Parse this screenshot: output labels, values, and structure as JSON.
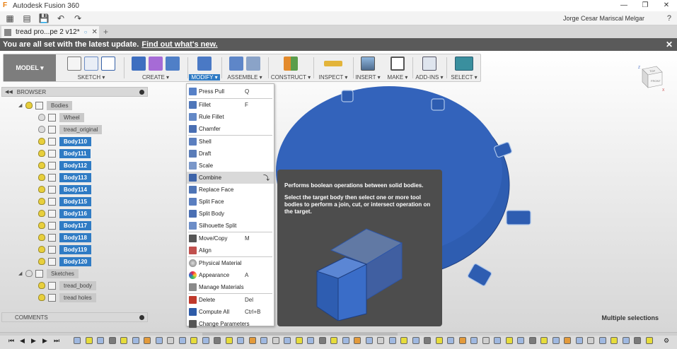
{
  "window": {
    "title": "Autodesk Fusion 360",
    "controls": [
      "—",
      "❐",
      "✕"
    ]
  },
  "app_toolbar": {
    "user_name": "Jorge Cesar Mariscal Melgar",
    "help": "?"
  },
  "document_tab": {
    "label": "tread pro...pe 2 v12*",
    "close": "✕",
    "add": "+"
  },
  "banner": {
    "message": "You are all set with the latest update.",
    "link": "Find out what's new.",
    "close": "✕"
  },
  "ribbon": {
    "workspace": "MODEL ▾",
    "groups": [
      {
        "label": "SKETCH ▾"
      },
      {
        "label": "CREATE ▾"
      },
      {
        "label": "MODIFY ▾",
        "active": true
      },
      {
        "label": "ASSEMBLE ▾"
      },
      {
        "label": "CONSTRUCT ▾"
      },
      {
        "label": "INSPECT ▾"
      },
      {
        "label": "INSERT ▾"
      },
      {
        "label": "MAKE ▾"
      },
      {
        "label": "ADD-INS ▾"
      },
      {
        "label": "SELECT ▾"
      }
    ]
  },
  "browser": {
    "title": "BROWSER",
    "items": [
      {
        "label": "Bodies",
        "state": "dim",
        "folder": true
      },
      {
        "label": "Wheel",
        "state": "dim"
      },
      {
        "label": "tread_original",
        "state": "dim"
      },
      {
        "label": "Body110",
        "state": "sel"
      },
      {
        "label": "Body111",
        "state": "sel"
      },
      {
        "label": "Body112",
        "state": "sel"
      },
      {
        "label": "Body113",
        "state": "sel"
      },
      {
        "label": "Body114",
        "state": "sel"
      },
      {
        "label": "Body115",
        "state": "sel"
      },
      {
        "label": "Body116",
        "state": "sel"
      },
      {
        "label": "Body117",
        "state": "sel"
      },
      {
        "label": "Body118",
        "state": "sel"
      },
      {
        "label": "Body119",
        "state": "sel"
      },
      {
        "label": "Body120",
        "state": "sel"
      },
      {
        "label": "Sketches",
        "state": "dim",
        "folder": true
      },
      {
        "label": "tread_body",
        "state": "dim"
      },
      {
        "label": "tread holes",
        "state": "dim"
      }
    ],
    "comments": "COMMENTS"
  },
  "modify_menu": {
    "items": [
      {
        "label": "Press Pull",
        "shortcut": "Q"
      },
      {
        "label": "Fillet",
        "shortcut": "F"
      },
      {
        "label": "Rule Fillet",
        "shortcut": ""
      },
      {
        "label": "Chamfer",
        "shortcut": ""
      },
      {
        "label": "Shell",
        "shortcut": ""
      },
      {
        "label": "Draft",
        "shortcut": ""
      },
      {
        "label": "Scale",
        "shortcut": ""
      },
      {
        "label": "Combine",
        "shortcut": "",
        "hover": true
      },
      {
        "label": "Replace Face",
        "shortcut": ""
      },
      {
        "label": "Split Face",
        "shortcut": ""
      },
      {
        "label": "Split Body",
        "shortcut": ""
      },
      {
        "label": "Silhouette Split",
        "shortcut": ""
      },
      {
        "label": "Move/Copy",
        "shortcut": "M"
      },
      {
        "label": "Align",
        "shortcut": ""
      },
      {
        "label": "Physical Material",
        "shortcut": ""
      },
      {
        "label": "Appearance",
        "shortcut": "A"
      },
      {
        "label": "Manage Materials",
        "shortcut": ""
      },
      {
        "label": "Delete",
        "shortcut": "Del"
      },
      {
        "label": "Compute All",
        "shortcut": "Ctrl+B"
      },
      {
        "label": "Change Parameters",
        "shortcut": ""
      }
    ]
  },
  "tooltip": {
    "heading": "Performs boolean operations between solid bodies.",
    "description": "Select the target body then select one or more tool bodies to perform a join, cut, or intersect operation on the target."
  },
  "status": {
    "text": "Multiple selections"
  },
  "view_cube": {
    "top": "TOP",
    "front": "FRONT",
    "axis_x": "X",
    "axis_z": "Z"
  },
  "colors": {
    "accent": "#2f7bc4",
    "body_blue": "#2e5db1",
    "banner": "#5a5a5a"
  }
}
